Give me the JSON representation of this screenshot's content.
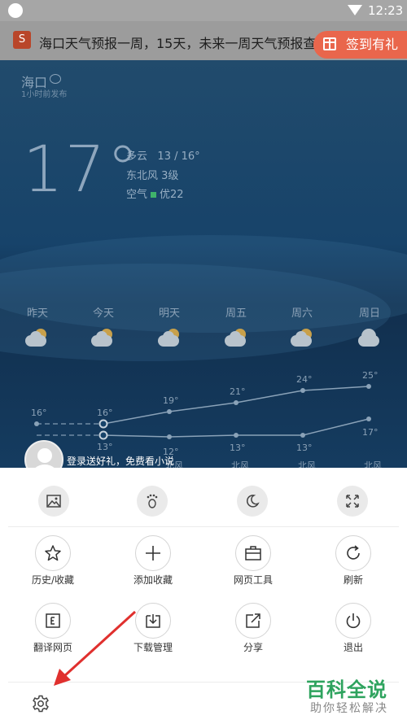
{
  "status_bar": {
    "time": "12:23"
  },
  "title_bar": {
    "logo": "S",
    "page_title": "海口天气预报一周，15天，未来一周天气预报查询"
  },
  "checkin": {
    "label": "签到有礼"
  },
  "weather": {
    "city": "海口",
    "published": "1小时前发布",
    "temperature": "17°",
    "condition": "多云",
    "range": "13 / 16°",
    "wind": "东北风 3级",
    "air_label": "空气",
    "air_quality": "优22",
    "air_color": "#3fb36b",
    "days": [
      "昨天",
      "今天",
      "明天",
      "周五",
      "周六",
      "周日"
    ],
    "icons": [
      "partly-cloudy-icon",
      "partly-cloudy-icon",
      "partly-cloudy-icon",
      "partly-cloudy-icon",
      "partly-cloudy-icon",
      "rain-cloud-icon"
    ],
    "highs": [
      "16°",
      "16°",
      "19°",
      "21°",
      "24°",
      "25°"
    ],
    "lows": [
      "",
      "13°",
      "12°",
      "13°",
      "13°",
      "17°"
    ],
    "winds": [
      "",
      "",
      "北风",
      "北风",
      "北风",
      "北风"
    ]
  },
  "login_prompt": {
    "text": "登录送好礼，免费看小说"
  },
  "menu": {
    "modes": [
      "image-icon",
      "footprint-icon",
      "night-mode-icon",
      "fullscreen-icon"
    ],
    "items": [
      {
        "label": "历史/收藏",
        "icon": "star-icon"
      },
      {
        "label": "添加收藏",
        "icon": "plus-icon"
      },
      {
        "label": "网页工具",
        "icon": "toolbox-icon"
      },
      {
        "label": "刷新",
        "icon": "refresh-icon"
      },
      {
        "label": "翻译网页",
        "icon": "translate-icon"
      },
      {
        "label": "下载管理",
        "icon": "download-icon"
      },
      {
        "label": "分享",
        "icon": "share-icon"
      },
      {
        "label": "退出",
        "icon": "power-icon"
      }
    ]
  },
  "watermark": {
    "line1": "百科全说",
    "line2": "助你轻松解决"
  },
  "colors": {
    "accent": "#e9664c",
    "annotation_arrow": "#e0302e"
  }
}
